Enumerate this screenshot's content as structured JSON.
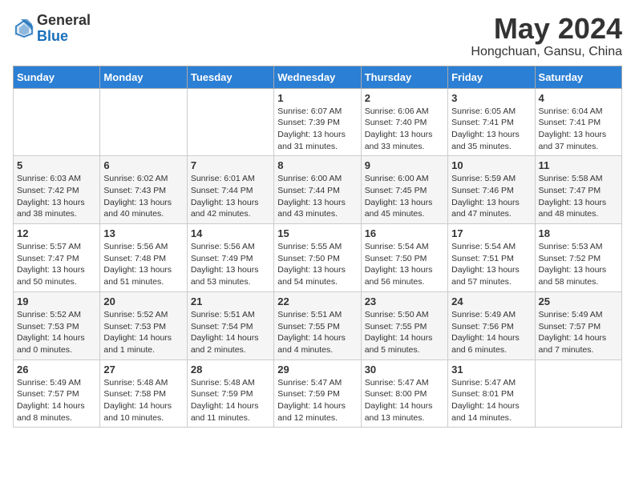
{
  "header": {
    "logo_general": "General",
    "logo_blue": "Blue",
    "month_title": "May 2024",
    "location": "Hongchuan, Gansu, China"
  },
  "weekdays": [
    "Sunday",
    "Monday",
    "Tuesday",
    "Wednesday",
    "Thursday",
    "Friday",
    "Saturday"
  ],
  "weeks": [
    [
      {
        "day": "",
        "info": ""
      },
      {
        "day": "",
        "info": ""
      },
      {
        "day": "",
        "info": ""
      },
      {
        "day": "1",
        "info": "Sunrise: 6:07 AM\nSunset: 7:39 PM\nDaylight: 13 hours\nand 31 minutes."
      },
      {
        "day": "2",
        "info": "Sunrise: 6:06 AM\nSunset: 7:40 PM\nDaylight: 13 hours\nand 33 minutes."
      },
      {
        "day": "3",
        "info": "Sunrise: 6:05 AM\nSunset: 7:41 PM\nDaylight: 13 hours\nand 35 minutes."
      },
      {
        "day": "4",
        "info": "Sunrise: 6:04 AM\nSunset: 7:41 PM\nDaylight: 13 hours\nand 37 minutes."
      }
    ],
    [
      {
        "day": "5",
        "info": "Sunrise: 6:03 AM\nSunset: 7:42 PM\nDaylight: 13 hours\nand 38 minutes."
      },
      {
        "day": "6",
        "info": "Sunrise: 6:02 AM\nSunset: 7:43 PM\nDaylight: 13 hours\nand 40 minutes."
      },
      {
        "day": "7",
        "info": "Sunrise: 6:01 AM\nSunset: 7:44 PM\nDaylight: 13 hours\nand 42 minutes."
      },
      {
        "day": "8",
        "info": "Sunrise: 6:00 AM\nSunset: 7:44 PM\nDaylight: 13 hours\nand 43 minutes."
      },
      {
        "day": "9",
        "info": "Sunrise: 6:00 AM\nSunset: 7:45 PM\nDaylight: 13 hours\nand 45 minutes."
      },
      {
        "day": "10",
        "info": "Sunrise: 5:59 AM\nSunset: 7:46 PM\nDaylight: 13 hours\nand 47 minutes."
      },
      {
        "day": "11",
        "info": "Sunrise: 5:58 AM\nSunset: 7:47 PM\nDaylight: 13 hours\nand 48 minutes."
      }
    ],
    [
      {
        "day": "12",
        "info": "Sunrise: 5:57 AM\nSunset: 7:47 PM\nDaylight: 13 hours\nand 50 minutes."
      },
      {
        "day": "13",
        "info": "Sunrise: 5:56 AM\nSunset: 7:48 PM\nDaylight: 13 hours\nand 51 minutes."
      },
      {
        "day": "14",
        "info": "Sunrise: 5:56 AM\nSunset: 7:49 PM\nDaylight: 13 hours\nand 53 minutes."
      },
      {
        "day": "15",
        "info": "Sunrise: 5:55 AM\nSunset: 7:50 PM\nDaylight: 13 hours\nand 54 minutes."
      },
      {
        "day": "16",
        "info": "Sunrise: 5:54 AM\nSunset: 7:50 PM\nDaylight: 13 hours\nand 56 minutes."
      },
      {
        "day": "17",
        "info": "Sunrise: 5:54 AM\nSunset: 7:51 PM\nDaylight: 13 hours\nand 57 minutes."
      },
      {
        "day": "18",
        "info": "Sunrise: 5:53 AM\nSunset: 7:52 PM\nDaylight: 13 hours\nand 58 minutes."
      }
    ],
    [
      {
        "day": "19",
        "info": "Sunrise: 5:52 AM\nSunset: 7:53 PM\nDaylight: 14 hours\nand 0 minutes."
      },
      {
        "day": "20",
        "info": "Sunrise: 5:52 AM\nSunset: 7:53 PM\nDaylight: 14 hours\nand 1 minute."
      },
      {
        "day": "21",
        "info": "Sunrise: 5:51 AM\nSunset: 7:54 PM\nDaylight: 14 hours\nand 2 minutes."
      },
      {
        "day": "22",
        "info": "Sunrise: 5:51 AM\nSunset: 7:55 PM\nDaylight: 14 hours\nand 4 minutes."
      },
      {
        "day": "23",
        "info": "Sunrise: 5:50 AM\nSunset: 7:55 PM\nDaylight: 14 hours\nand 5 minutes."
      },
      {
        "day": "24",
        "info": "Sunrise: 5:49 AM\nSunset: 7:56 PM\nDaylight: 14 hours\nand 6 minutes."
      },
      {
        "day": "25",
        "info": "Sunrise: 5:49 AM\nSunset: 7:57 PM\nDaylight: 14 hours\nand 7 minutes."
      }
    ],
    [
      {
        "day": "26",
        "info": "Sunrise: 5:49 AM\nSunset: 7:57 PM\nDaylight: 14 hours\nand 8 minutes."
      },
      {
        "day": "27",
        "info": "Sunrise: 5:48 AM\nSunset: 7:58 PM\nDaylight: 14 hours\nand 10 minutes."
      },
      {
        "day": "28",
        "info": "Sunrise: 5:48 AM\nSunset: 7:59 PM\nDaylight: 14 hours\nand 11 minutes."
      },
      {
        "day": "29",
        "info": "Sunrise: 5:47 AM\nSunset: 7:59 PM\nDaylight: 14 hours\nand 12 minutes."
      },
      {
        "day": "30",
        "info": "Sunrise: 5:47 AM\nSunset: 8:00 PM\nDaylight: 14 hours\nand 13 minutes."
      },
      {
        "day": "31",
        "info": "Sunrise: 5:47 AM\nSunset: 8:01 PM\nDaylight: 14 hours\nand 14 minutes."
      },
      {
        "day": "",
        "info": ""
      }
    ]
  ]
}
